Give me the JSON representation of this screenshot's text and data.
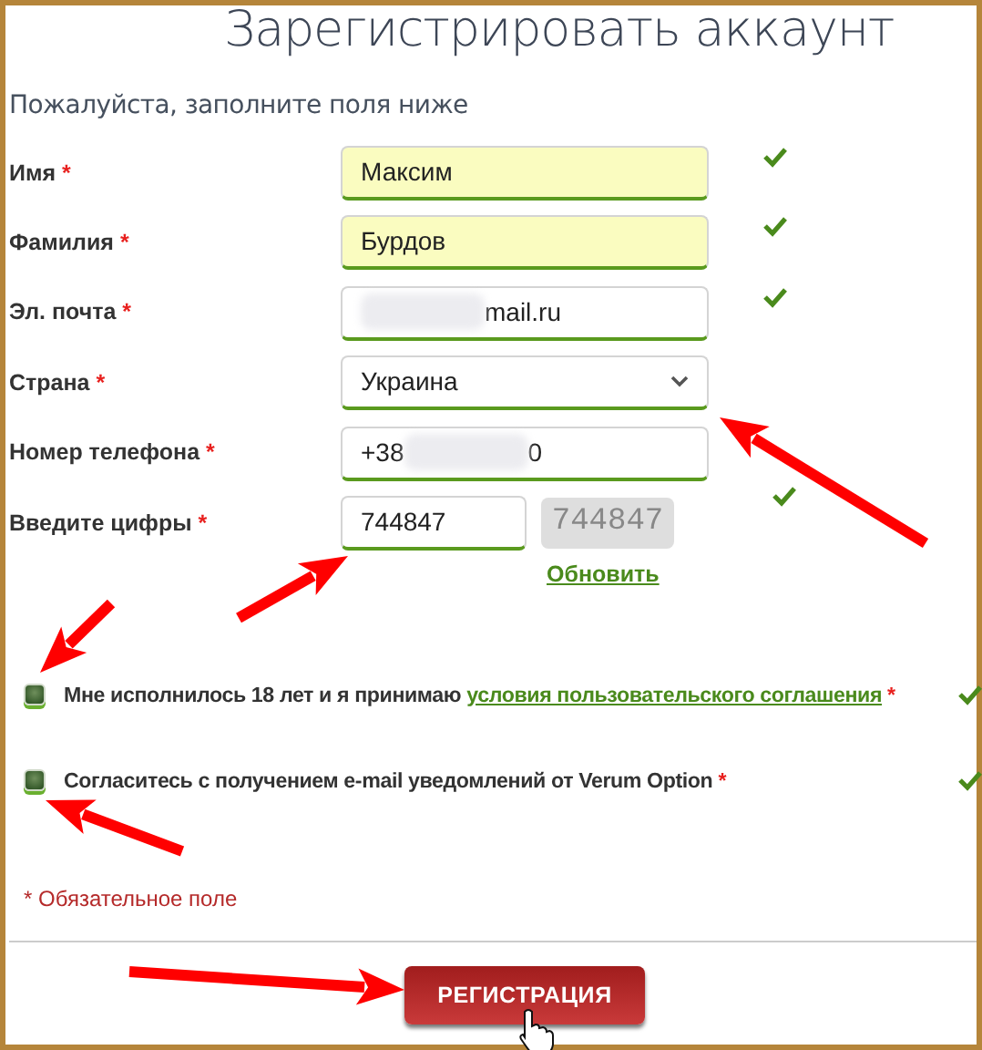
{
  "title": "Зарегистрировать аккаунт",
  "subtitle": "Пожалуйста, заполните поля ниже",
  "fields": [
    {
      "kind": "text",
      "label": "Имя",
      "required_mark": "*",
      "segments": [
        {
          "kind": "text",
          "text": "Максим"
        }
      ],
      "autofilled": true,
      "valid": true
    },
    {
      "kind": "text",
      "label": "Фамилия",
      "required_mark": "*",
      "segments": [
        {
          "kind": "text",
          "text": "Бурдов"
        }
      ],
      "autofilled": true,
      "valid": true
    },
    {
      "kind": "text",
      "label": "Эл. почта",
      "required_mark": "*",
      "segments": [
        {
          "kind": "blur"
        },
        {
          "kind": "text",
          "text": "mail.ru"
        }
      ],
      "autofilled": false,
      "valid": true
    },
    {
      "kind": "select",
      "label": "Страна",
      "required_mark": "*",
      "segments": [
        {
          "kind": "text",
          "text": "Украина"
        }
      ],
      "autofilled": false,
      "valid": false
    },
    {
      "kind": "text",
      "label": "Номер телефона",
      "required_mark": "*",
      "segments": [
        {
          "kind": "text",
          "text": "+38"
        },
        {
          "kind": "blur"
        },
        {
          "kind": "text",
          "text": "0"
        }
      ],
      "autofilled": false,
      "valid": false
    },
    {
      "kind": "captcha",
      "label": "Введите цифры",
      "required_mark": "*",
      "segments": [
        {
          "kind": "text",
          "text": "744847"
        }
      ],
      "autofilled": false,
      "valid": true,
      "captcha_text": "744847",
      "refresh_link": "Обновить"
    }
  ],
  "agreements": [
    {
      "text_before": "Мне исполнилось 18 лет и я принимаю",
      "link": "условия пользовательского соглашения",
      "required_mark": "*",
      "checked": true,
      "valid": true
    },
    {
      "text_before": "Согласитесь с получением e-mail уведомлений от Verum Option",
      "required_mark": "*",
      "checked": true,
      "valid": true
    }
  ],
  "required_note": "* Обязательное поле",
  "submit_button": "РЕГИСТРАЦИЯ",
  "annotations": [
    {
      "kind": "arrow"
    },
    {
      "kind": "arrow"
    },
    {
      "kind": "arrow"
    },
    {
      "kind": "arrow"
    },
    {
      "kind": "arrow"
    },
    {
      "kind": "cursor"
    }
  ]
}
